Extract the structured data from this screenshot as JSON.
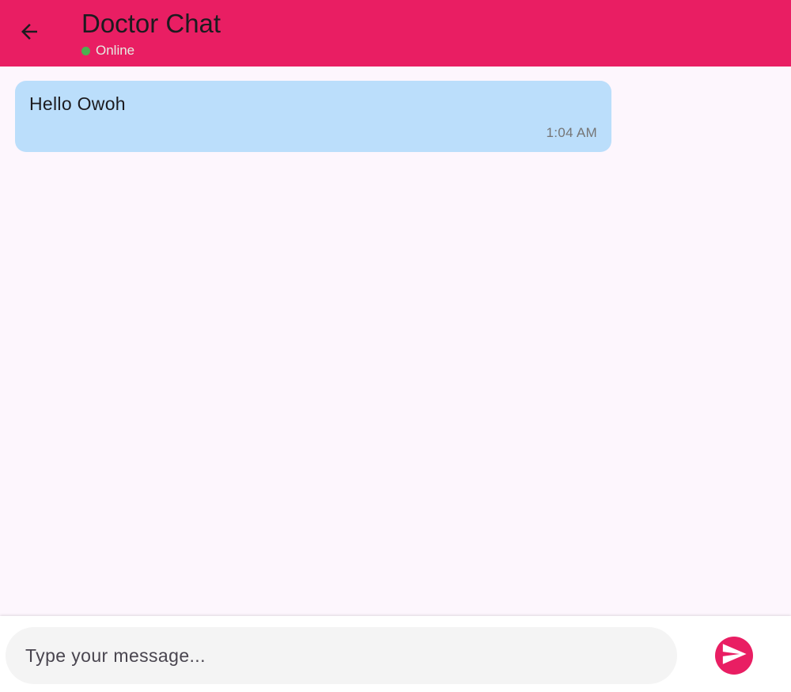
{
  "header": {
    "title": "Doctor Chat",
    "status": "Online",
    "back_icon": "arrow-left-icon",
    "status_icon": "online-dot-icon"
  },
  "messages": [
    {
      "text": "Hello Owoh",
      "time": "1:04 AM"
    }
  ],
  "composer": {
    "input_value": "",
    "placeholder": "Type your message...",
    "send_icon": "send-icon"
  },
  "colors": {
    "accent": "#e91e63",
    "background": "#fdf6fd",
    "bubble": "#bbdefb",
    "online": "#4caf50"
  }
}
